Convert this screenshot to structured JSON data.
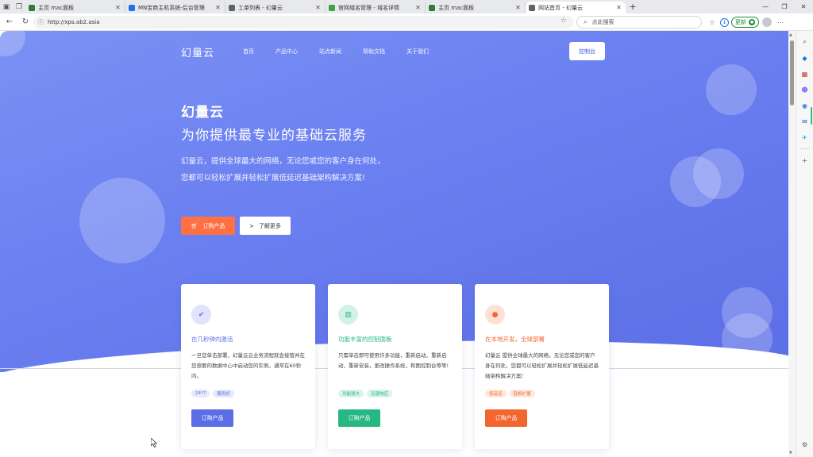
{
  "browser": {
    "tabs": [
      {
        "label": "主页 mac面板",
        "fav_color": "#2e7d32",
        "active": false
      },
      {
        "label": "MN宝商主机系统-后台管理",
        "fav_color": "#1a73e8",
        "active": false
      },
      {
        "label": "工单列表 - 幻量云",
        "fav_color": "#5f6368",
        "active": false
      },
      {
        "label": "官网域名管理 - 域名详情",
        "fav_color": "#43a047",
        "active": false
      },
      {
        "label": "主页 mac面板",
        "fav_color": "#2e7d32",
        "active": false
      },
      {
        "label": "网站首页 - 幻量云",
        "fav_color": "#5f6368",
        "active": true
      }
    ],
    "url": "http://xps.ab2.asia",
    "search_placeholder": "点此搜索",
    "update_label": "更新"
  },
  "site": {
    "logo": "幻量云",
    "nav": [
      "首页",
      "产品中心",
      "站点新闻",
      "帮助文档",
      "关于我们"
    ],
    "console_label": "控制台",
    "hero": {
      "title": "幻量云",
      "subtitle": "为你提供最专业的基础云服务",
      "description": "幻量云，提供全球最大的网络，无论您或您的客户身在何处，您都可以轻松扩展并轻松扩展低延迟基础架构解决方案!",
      "order_label": "订购产品",
      "more_label": "了解更多"
    },
    "cards": [
      {
        "title": "在几秒钟内激活",
        "title_color": "#5b6ee6",
        "desc": "一旦您单击部署，幻量云云业务流程就会接管并在您想要的数据中心中启动您的实例，通常在60秒内。",
        "tags": [
          "24*7",
          "服务好"
        ],
        "tag_bg": "#e6e9fb",
        "tag_color": "#5b6ee6",
        "button": "订购产品",
        "accent": "#5b6ee6",
        "icon_bg": "#dfe3fb",
        "icon": "check-icon",
        "icon_glyph": "✔"
      },
      {
        "title": "功能丰富的控制面板",
        "title_color": "#27b783",
        "desc": "只需单击即可使用许多功能，重新启动，重新启动，重新安装，更改操作系统，和图控制台等等!",
        "tags": [
          "功能强大",
          "迅速响应"
        ],
        "tag_bg": "#daf4ea",
        "tag_color": "#27b783",
        "button": "订购产品",
        "accent": "#27b783",
        "icon_bg": "#d3f2e6",
        "icon": "dashboard-icon",
        "icon_glyph": "▥"
      },
      {
        "title": "在本地开发，全球部署",
        "title_color": "#f2672f",
        "desc": "幻量云 提供全球最大的网络，无论您或您的客户身在何处，您都可以轻松扩展并轻松扩展低延迟基础架构解决方案!",
        "tags": [
          "低延迟",
          "轻松扩展"
        ],
        "tag_bg": "#fde6dc",
        "tag_color": "#f2672f",
        "button": "订购产品",
        "accent": "#f2672f",
        "icon_bg": "#fde1d5",
        "icon": "globe-icon",
        "icon_glyph": "●"
      }
    ]
  }
}
